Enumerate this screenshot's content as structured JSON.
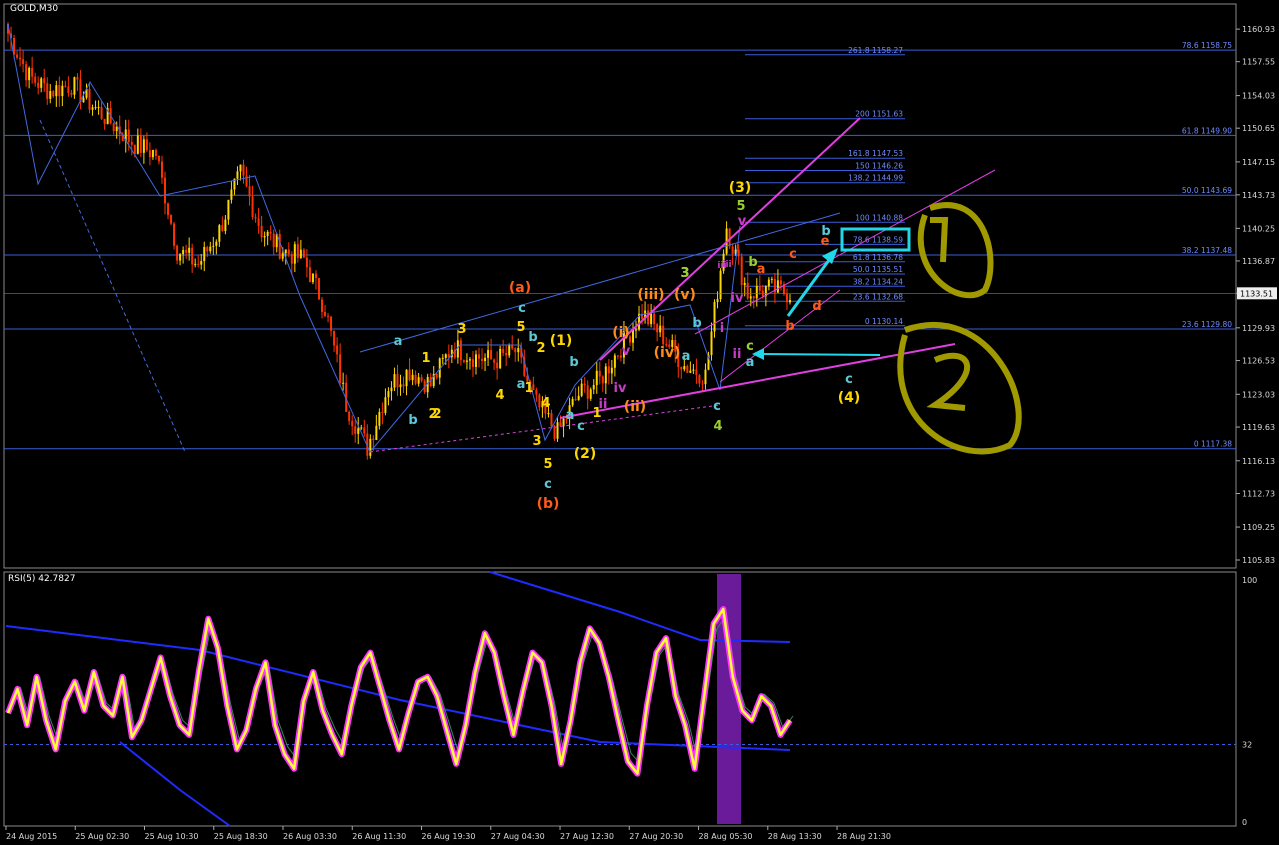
{
  "main_chart": {
    "symbol_label": "GOLD,M30",
    "price_axis": [
      "1160.93",
      "1157.55",
      "1154.03",
      "1150.65",
      "1147.15",
      "1143.73",
      "1140.25",
      "1136.87",
      "1133.51",
      "1129.93",
      "1126.53",
      "1123.03",
      "1119.63",
      "1116.13",
      "1112.73",
      "1109.25",
      "1105.83"
    ],
    "current_price": "1133.51",
    "fib_levels_right": [
      {
        "label": "78.6 1158.75",
        "price": 1158.75
      },
      {
        "label": "61.8 1149.90",
        "price": 1149.9
      },
      {
        "label": "50.0 1143.69",
        "price": 1143.69
      },
      {
        "label": "38.2 1137.48",
        "price": 1137.48
      },
      {
        "label": "23.6 1129.80",
        "price": 1129.8
      },
      {
        "label": "0 1117.38",
        "price": 1117.38
      }
    ],
    "fib_levels_mid": [
      {
        "label": "261.8 1158.27",
        "price": 1158.27
      },
      {
        "label": "200 1151.63",
        "price": 1151.63
      },
      {
        "label": "161.8 1147.53",
        "price": 1147.53
      },
      {
        "label": "150 1146.26",
        "price": 1146.26
      },
      {
        "label": "138.2 1144.99",
        "price": 1144.99
      },
      {
        "label": "100 1140.88",
        "price": 1140.88
      },
      {
        "label": "78.6 1138.59",
        "price": 1138.59
      },
      {
        "label": "61.8 1136.78",
        "price": 1136.78
      },
      {
        "label": "50.0 1135.51",
        "price": 1135.51
      },
      {
        "label": "38.2 1134.24",
        "price": 1134.24
      },
      {
        "label": "23.6 1132.68",
        "price": 1132.68
      },
      {
        "label": "0 1130.14",
        "price": 1130.14
      }
    ],
    "wave_labels": [
      {
        "t": "(a)",
        "c": "#ff5a1a"
      },
      {
        "t": "c",
        "c": "#5bc8d6"
      },
      {
        "t": "5",
        "c": "#ffd700"
      },
      {
        "t": "b",
        "c": "#5bc8d6"
      },
      {
        "t": "2",
        "c": "#ffd700"
      },
      {
        "t": "(1)",
        "c": "#ffd700"
      },
      {
        "t": "a",
        "c": "#5bc8d6"
      },
      {
        "t": "1",
        "c": "#ffd700"
      },
      {
        "t": "3",
        "c": "#ffd700"
      },
      {
        "t": "b",
        "c": "#5bc8d6"
      },
      {
        "t": "2",
        "c": "#ffd700"
      },
      {
        "t": "4",
        "c": "#ffd700"
      },
      {
        "t": "a",
        "c": "#5bc8d6"
      },
      {
        "t": "1",
        "c": "#ffd700"
      },
      {
        "t": "4",
        "c": "#ffd700"
      },
      {
        "t": "3",
        "c": "#ffd700"
      },
      {
        "t": "5",
        "c": "#ffd700"
      },
      {
        "t": "c",
        "c": "#5bc8d6"
      },
      {
        "t": "(b)",
        "c": "#ff5a1a"
      },
      {
        "t": "(2)",
        "c": "#ffd700"
      },
      {
        "t": "b",
        "c": "#5bc8d6"
      },
      {
        "t": "c",
        "c": "#5bc8d6"
      },
      {
        "t": "a",
        "c": "#5bc8d6"
      },
      {
        "t": "1",
        "c": "#ffd700"
      },
      {
        "t": "2",
        "c": "#ffd700"
      },
      {
        "t": "3",
        "c": "#ffd700"
      },
      {
        "t": "(i)",
        "c": "#ff8c1a"
      },
      {
        "t": "(ii)",
        "c": "#ff8c1a"
      },
      {
        "t": "(iii)",
        "c": "#ff8c1a"
      },
      {
        "t": "(iv)",
        "c": "#ff8c1a"
      },
      {
        "t": "(v)",
        "c": "#ff8c1a"
      },
      {
        "t": "iii",
        "c": "#c83cc8"
      },
      {
        "t": "iv",
        "c": "#c83cc8"
      },
      {
        "t": "v",
        "c": "#c83cc8"
      },
      {
        "t": "ii",
        "c": "#c83cc8"
      },
      {
        "t": "3",
        "c": "#9acd32"
      },
      {
        "t": "a",
        "c": "#5bc8d6"
      },
      {
        "t": "b",
        "c": "#5bc8d6"
      },
      {
        "t": "c",
        "c": "#5bc8d6"
      },
      {
        "t": "4",
        "c": "#9acd32"
      },
      {
        "t": "(3)",
        "c": "#ffd700"
      },
      {
        "t": "5",
        "c": "#9acd32"
      },
      {
        "t": "v",
        "c": "#c83cc8"
      },
      {
        "t": "iii",
        "c": "#c83cc8"
      },
      {
        "t": "i",
        "c": "#c83cc8"
      },
      {
        "t": "ii",
        "c": "#c83cc8"
      },
      {
        "t": "iv",
        "c": "#c83cc8"
      },
      {
        "t": "a",
        "c": "#5bc8d6"
      },
      {
        "t": "c",
        "c": "#9acd32"
      },
      {
        "t": "a",
        "c": "#ff5a1a"
      },
      {
        "t": "b",
        "c": "#9acd32"
      },
      {
        "t": "c",
        "c": "#ff5a1a"
      },
      {
        "t": "d",
        "c": "#ff5a1a"
      },
      {
        "t": "e",
        "c": "#ff5a1a"
      },
      {
        "t": "b",
        "c": "#ff5a1a"
      },
      {
        "t": "b",
        "c": "#5bc8d6"
      },
      {
        "t": "c",
        "c": "#5bc8d6"
      },
      {
        "t": "(4)",
        "c": "#ffd700"
      }
    ]
  },
  "rsi_panel": {
    "label": "RSI(5) 42.7827",
    "axis_labels": [
      "100",
      "32",
      "0"
    ]
  },
  "time_axis": [
    "24 Aug 2015",
    "25 Aug 02:30",
    "25 Aug 10:30",
    "25 Aug 18:30",
    "26 Aug 03:30",
    "26 Aug 11:30",
    "26 Aug 19:30",
    "27 Aug 04:30",
    "27 Aug 12:30",
    "27 Aug 20:30",
    "28 Aug 05:30",
    "28 Aug 13:30",
    "28 Aug 21:30"
  ],
  "colors": {
    "background": "#000000",
    "bull_candle": "#ffd700",
    "bear_candle": "#ff3300",
    "grid_line": "#3a5fd9",
    "wave_line": "#4169e1",
    "channel": "#e040e0",
    "arrow": "#22d8e8",
    "annotation": "#a09a00",
    "rsi_main": "#ffff33",
    "rsi_glow": "#ff33ff",
    "rsi_band": "#6a1b9a"
  },
  "chart_data": {
    "type": "candlestick",
    "symbol": "GOLD",
    "timeframe": "M30",
    "ylim": [
      1105.83,
      1162.5
    ],
    "close_path": [
      {
        "t": "24 Aug 2015",
        "p": 1160.5
      },
      {
        "t": "24 Aug 2015",
        "p": 1156.0
      },
      {
        "t": "24 Aug 2015",
        "p": 1154.5
      },
      {
        "t": "25 Aug 02:30",
        "p": 1155.2
      },
      {
        "t": "25 Aug 02:30",
        "p": 1153.0
      },
      {
        "t": "25 Aug 10:30",
        "p": 1151.0
      },
      {
        "t": "25 Aug 10:30",
        "p": 1149.0
      },
      {
        "t": "25 Aug 10:30",
        "p": 1148.0
      },
      {
        "t": "25 Aug 18:30",
        "p": 1138.0
      },
      {
        "t": "25 Aug 18:30",
        "p": 1136.5
      },
      {
        "t": "25 Aug 18:30",
        "p": 1140.0
      },
      {
        "t": "26 Aug 03:30",
        "p": 1146.0
      },
      {
        "t": "26 Aug 03:30",
        "p": 1140.0
      },
      {
        "t": "26 Aug 03:30",
        "p": 1138.0
      },
      {
        "t": "26 Aug 03:30",
        "p": 1137.0
      },
      {
        "t": "26 Aug 11:30",
        "p": 1132.0
      },
      {
        "t": "26 Aug 11:30",
        "p": 1122.0
      },
      {
        "t": "26 Aug 11:30",
        "p": 1117.5
      },
      {
        "t": "26 Aug 19:30",
        "p": 1124.0
      },
      {
        "t": "26 Aug 19:30",
        "p": 1125.5
      },
      {
        "t": "26 Aug 19:30",
        "p": 1124.0
      },
      {
        "t": "27 Aug 04:30",
        "p": 1128.0
      },
      {
        "t": "27 Aug 04:30",
        "p": 1127.0
      },
      {
        "t": "27 Aug 04:30",
        "p": 1126.5
      },
      {
        "t": "27 Aug 12:30",
        "p": 1127.5
      },
      {
        "t": "27 Aug 12:30",
        "p": 1122.0
      },
      {
        "t": "27 Aug 12:30",
        "p": 1119.0
      },
      {
        "t": "27 Aug 20:30",
        "p": 1123.0
      },
      {
        "t": "27 Aug 20:30",
        "p": 1124.5
      },
      {
        "t": "27 Aug 20:30",
        "p": 1128.0
      },
      {
        "t": "28 Aug 05:30",
        "p": 1131.5
      },
      {
        "t": "28 Aug 05:30",
        "p": 1129.0
      },
      {
        "t": "28 Aug 05:30",
        "p": 1126.0
      },
      {
        "t": "28 Aug 13:30",
        "p": 1125.0
      },
      {
        "t": "28 Aug 13:30",
        "p": 1140.5
      },
      {
        "t": "28 Aug 13:30",
        "p": 1133.5
      },
      {
        "t": "28 Aug 21:30",
        "p": 1134.0
      },
      {
        "t": "28 Aug 21:30",
        "p": 1133.5
      }
    ],
    "rsi": {
      "period": 5,
      "last_value": 42.7827,
      "level": 32,
      "ylim": [
        0,
        100
      ],
      "values": [
        45,
        55,
        40,
        60,
        42,
        30,
        50,
        58,
        46,
        62,
        48,
        44,
        60,
        35,
        42,
        55,
        68,
        52,
        40,
        36,
        62,
        84,
        72,
        48,
        30,
        38,
        55,
        66,
        40,
        28,
        22,
        50,
        62,
        46,
        36,
        28,
        48,
        64,
        70,
        56,
        42,
        30,
        45,
        58,
        60,
        52,
        38,
        24,
        40,
        62,
        78,
        70,
        52,
        36,
        54,
        70,
        66,
        48,
        24,
        42,
        66,
        80,
        74,
        60,
        42,
        25,
        20,
        48,
        70,
        76,
        52,
        40,
        22,
        52,
        82,
        88,
        60,
        46,
        42,
        52,
        48,
        36,
        42
      ]
    }
  }
}
